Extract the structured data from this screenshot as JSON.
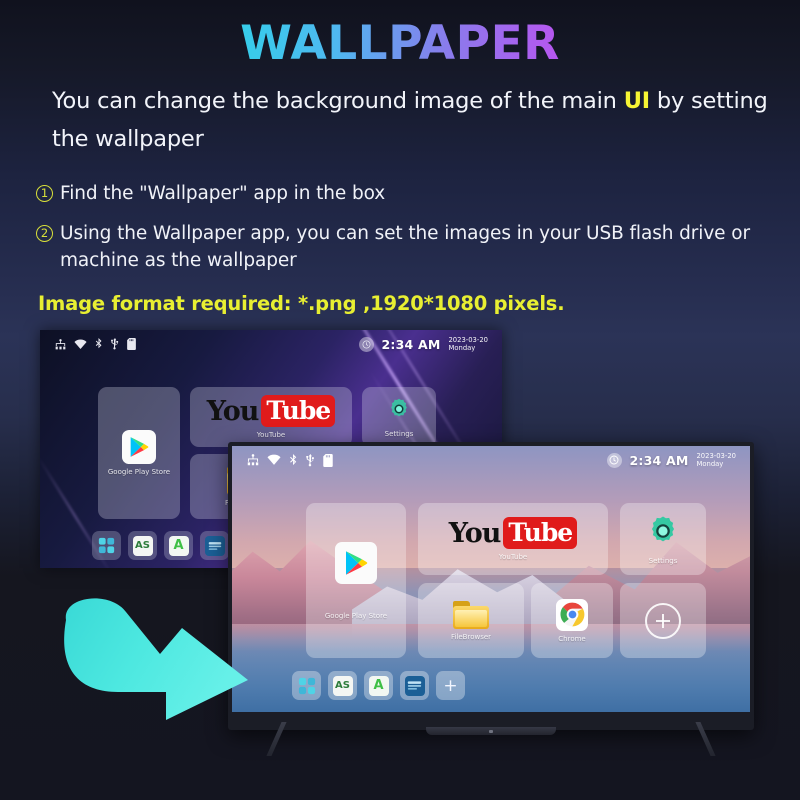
{
  "title": "WALLPAPER",
  "intro": {
    "before": "You can change the background image of the main ",
    "highlight": "UI",
    "after": " by setting the wallpaper"
  },
  "steps": [
    {
      "num": "1",
      "text": "Find the \"Wallpaper\" app in the box"
    },
    {
      "num": "2",
      "text": "Using the Wallpaper app, you can set the images in your USB flash drive or machine as the wallpaper"
    }
  ],
  "note": "Image format required: *.png ,1920*1080 pixels.",
  "colors": {
    "title_gradient_start": "#2ee6e0",
    "title_gradient_end": "#f42fc9",
    "highlight_yellow": "#f7f534",
    "note_yellow": "#e8ef32",
    "arrow_cyan": "#4de8e0",
    "youtube_red": "#e01b1b",
    "settings_gear": "#3fd9b0",
    "background_top": "#10121e",
    "background_bottom": "#141520"
  },
  "arrow": {
    "icon": "curved-arrow-right-icon",
    "color": "#4de8e0"
  },
  "tv_back": {
    "label": "before-wallpaper-screen",
    "status_icons": [
      "network-icon",
      "wifi-icon",
      "bluetooth-icon",
      "usb-icon",
      "sdcard-icon"
    ],
    "time": "2:34 AM",
    "date": "2023-03-20",
    "weekday": "Monday",
    "apps": [
      {
        "name": "Google Play Store",
        "icon": "google-play-icon"
      },
      {
        "name": "YouTube",
        "icon": "youtube-icon",
        "logo_you": "You",
        "logo_tube": "Tube"
      },
      {
        "name": "Settings",
        "icon": "gear-icon"
      },
      {
        "name": "FileBrowser",
        "icon": "folder-icon"
      }
    ],
    "dock": [
      {
        "name": "all-apps",
        "icon": "app-grid-icon"
      },
      {
        "name": "as-store",
        "icon": "as-icon",
        "label": "AS"
      },
      {
        "name": "aptoide",
        "icon": "aptoide-a-icon",
        "label": "A"
      },
      {
        "name": "media-app",
        "icon": "media-icon"
      },
      {
        "name": "add-shortcut",
        "icon": "plus-icon",
        "label": "+"
      }
    ]
  },
  "tv_front": {
    "label": "after-wallpaper-screen",
    "wallpaper": "mountain-lake-sunset",
    "status_icons": [
      "network-icon",
      "wifi-icon",
      "bluetooth-icon",
      "usb-icon",
      "sdcard-icon"
    ],
    "time": "2:34 AM",
    "date": "2023-03-20",
    "weekday": "Monday",
    "apps": [
      {
        "name": "Google Play Store",
        "icon": "google-play-icon"
      },
      {
        "name": "YouTube",
        "icon": "youtube-icon",
        "logo_you": "You",
        "logo_tube": "Tube"
      },
      {
        "name": "Settings",
        "icon": "gear-icon"
      },
      {
        "name": "FileBrowser",
        "icon": "folder-icon"
      },
      {
        "name": "Chrome",
        "icon": "chrome-icon"
      },
      {
        "name": "Add",
        "icon": "plus-circle-icon"
      }
    ],
    "dock": [
      {
        "name": "all-apps",
        "icon": "app-grid-icon"
      },
      {
        "name": "as-store",
        "icon": "as-icon",
        "label": "AS"
      },
      {
        "name": "aptoide",
        "icon": "aptoide-a-icon",
        "label": "A"
      },
      {
        "name": "media-app",
        "icon": "media-icon"
      },
      {
        "name": "add-shortcut",
        "icon": "plus-icon",
        "label": "+"
      }
    ]
  }
}
